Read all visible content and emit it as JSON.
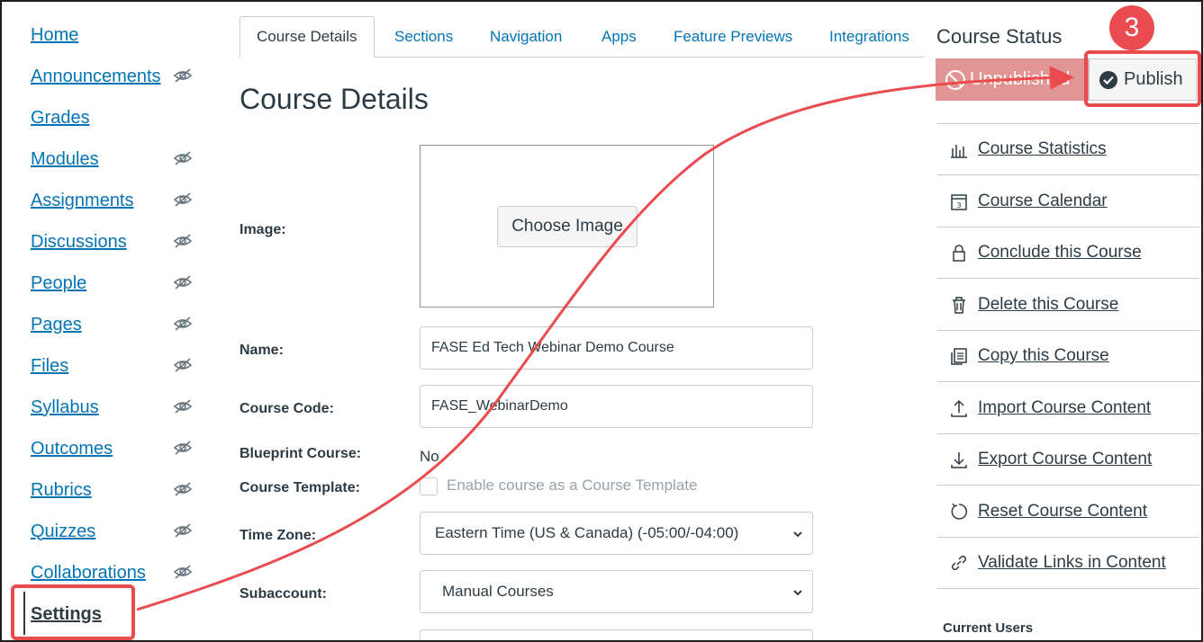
{
  "nav": {
    "items": [
      {
        "label": "Home",
        "hidden": false
      },
      {
        "label": "Announcements",
        "hidden": true
      },
      {
        "label": "Grades",
        "hidden": false
      },
      {
        "label": "Modules",
        "hidden": true
      },
      {
        "label": "Assignments",
        "hidden": true
      },
      {
        "label": "Discussions",
        "hidden": true
      },
      {
        "label": "People",
        "hidden": true
      },
      {
        "label": "Pages",
        "hidden": true
      },
      {
        "label": "Files",
        "hidden": true
      },
      {
        "label": "Syllabus",
        "hidden": true
      },
      {
        "label": "Outcomes",
        "hidden": true
      },
      {
        "label": "Rubrics",
        "hidden": true
      },
      {
        "label": "Quizzes",
        "hidden": true
      },
      {
        "label": "Collaborations",
        "hidden": true
      },
      {
        "label": "Settings",
        "hidden": false,
        "active": true
      }
    ]
  },
  "tabs": [
    "Course Details",
    "Sections",
    "Navigation",
    "Apps",
    "Feature Previews",
    "Integrations"
  ],
  "main": {
    "title": "Course Details",
    "image_label": "Image:",
    "choose_image": "Choose Image",
    "name_label": "Name:",
    "name_value": "FASE Ed Tech Webinar Demo Course",
    "code_label": "Course Code:",
    "code_value": "FASE_WebinarDemo",
    "blueprint_label": "Blueprint Course:",
    "blueprint_value": "No",
    "template_label": "Course Template:",
    "template_checkbox": "Enable course as a Course Template",
    "timezone_label": "Time Zone:",
    "timezone_value": "Eastern Time (US & Canada) (-05:00/-04:00)",
    "subaccount_label": "Subaccount:",
    "subaccount_value": "Manual Courses"
  },
  "status": {
    "title": "Course Status",
    "unpublished": "Unpublished",
    "publish": "Publish",
    "step": "3"
  },
  "sidebar": {
    "items": [
      {
        "label": "Course Statistics",
        "icon": "stats-icon"
      },
      {
        "label": "Course Calendar",
        "icon": "calendar-icon"
      },
      {
        "label": "Conclude this Course",
        "icon": "lock-icon"
      },
      {
        "label": "Delete this Course",
        "icon": "trash-icon"
      },
      {
        "label": "Copy this Course",
        "icon": "copy-icon"
      },
      {
        "label": "Import Course Content",
        "icon": "upload-icon"
      },
      {
        "label": "Export Course Content",
        "icon": "download-icon"
      },
      {
        "label": "Reset Course Content",
        "icon": "reset-icon"
      },
      {
        "label": "Validate Links in Content",
        "icon": "link-icon"
      }
    ],
    "current_users": "Current Users"
  },
  "colors": {
    "link": "#0374b5",
    "text": "#2d3b45",
    "annotation": "#ea4b4f",
    "unpublished_bg": "#e29595"
  }
}
